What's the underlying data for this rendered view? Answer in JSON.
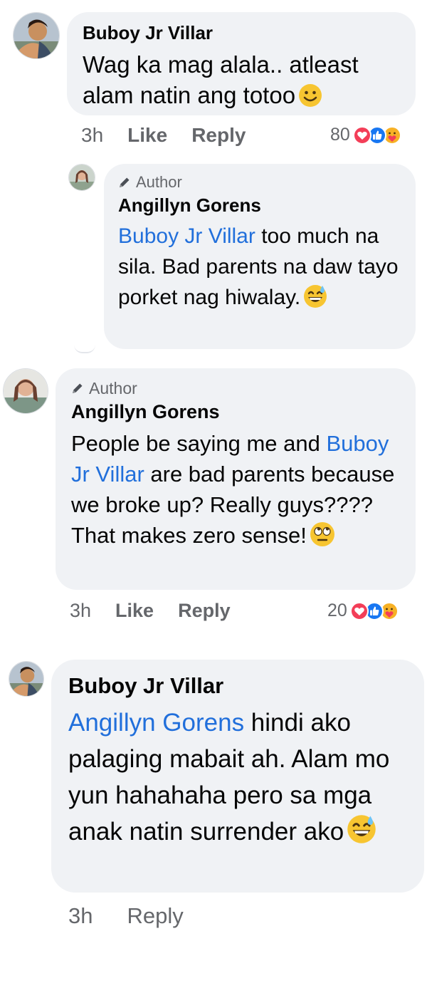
{
  "comments": [
    {
      "author": "Buboy Jr Villar",
      "author_badge": "",
      "mention": "",
      "text": "Wag ka mag alala.. atleast alam natin ang totoo",
      "emoji": "smile",
      "time": "3h",
      "like_label": "Like",
      "reply_label": "Reply",
      "reaction_count": "80"
    },
    {
      "author": "Angillyn Gorens",
      "author_badge": "Author",
      "mention": "Buboy Jr Villar",
      "text": " too much na sila. Bad parents na daw tayo porket nag hiwalay.",
      "emoji": "sweat-smile"
    },
    {
      "author": "Angillyn Gorens",
      "author_badge": "Author",
      "text_before": "People be saying me and ",
      "mention": "Buboy Jr Villar",
      "text": " are bad parents because we broke up? Really guys???? That makes zero sense!",
      "emoji": "eye-roll",
      "time": "3h",
      "like_label": "Like",
      "reply_label": "Reply",
      "reaction_count": "20"
    },
    {
      "author": "Buboy Jr Villar",
      "author_badge": "",
      "mention": "Angillyn Gorens",
      "text": " hindi ako palaging mabait ah. Alam mo yun hahahaha pero sa mga anak natin surrender ako",
      "emoji": "sweat-smile",
      "time": "3h",
      "reply_label": "Reply"
    }
  ],
  "reaction_icons": [
    "love-reaction-icon",
    "like-reaction-icon",
    "care-reaction-icon"
  ],
  "colors": {
    "bubble": "#f0f2f5",
    "mention": "#216fdb",
    "meta": "#65676b",
    "like": "#1877f2",
    "love": "#f33e58",
    "care": "#f7b125"
  }
}
